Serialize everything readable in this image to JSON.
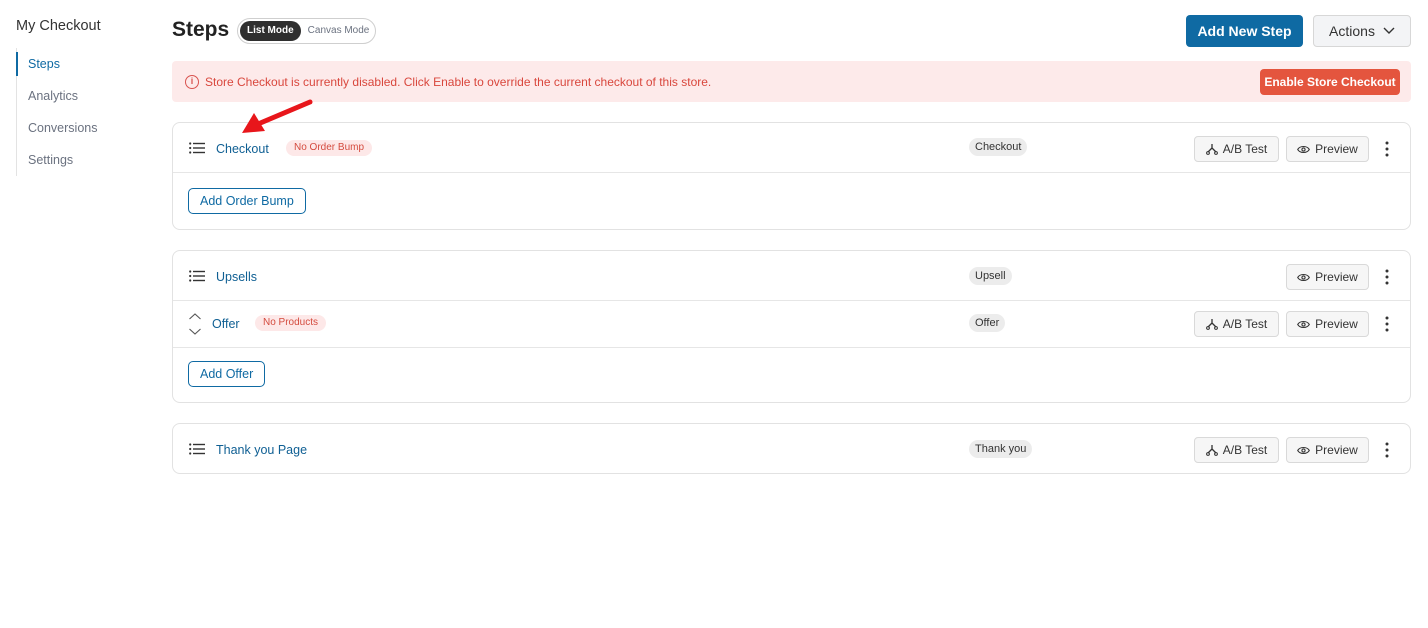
{
  "sidebar": {
    "title": "My Checkout",
    "items": [
      {
        "label": "Steps",
        "active": true
      },
      {
        "label": "Analytics",
        "active": false
      },
      {
        "label": "Conversions",
        "active": false
      },
      {
        "label": "Settings",
        "active": false
      }
    ]
  },
  "header": {
    "title": "Steps",
    "modes": [
      "List Mode",
      "Canvas Mode"
    ],
    "active_mode": "List Mode",
    "add_step_label": "Add New Step",
    "actions_label": "Actions"
  },
  "alert": {
    "text": "Store Checkout is currently disabled. Click Enable to override the current checkout of this store.",
    "button_label": "Enable Store Checkout",
    "icon": "info-icon"
  },
  "cards": {
    "checkout": {
      "step_label": "Checkout",
      "badge": "No Order Bump",
      "type": "Checkout",
      "ab_label": "A/B Test",
      "preview_label": "Preview",
      "add_label": "Add Order Bump"
    },
    "upsells": {
      "step_label": "Upsells",
      "type": "Upsell",
      "preview_label": "Preview",
      "offer": {
        "label": "Offer",
        "badge": "No Products",
        "type": "Offer",
        "ab_label": "A/B Test",
        "preview_label": "Preview"
      },
      "add_label": "Add Offer"
    },
    "thankyou": {
      "step_label": "Thank you Page",
      "type": "Thank you",
      "ab_label": "A/B Test",
      "preview_label": "Preview"
    }
  },
  "colors": {
    "primary": "#0f6aa3",
    "alert_bg": "#fdeaea",
    "alert_text": "#d9473d",
    "alert_button": "#e4553e",
    "annotation_arrow": "#e8161b"
  }
}
